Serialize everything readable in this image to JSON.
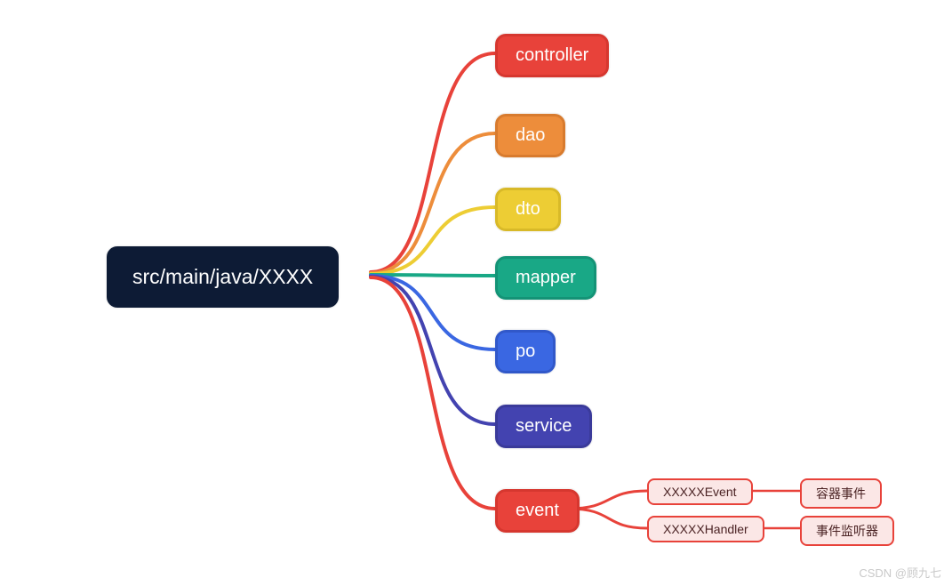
{
  "root": {
    "label": "src/main/java/XXXX"
  },
  "children": [
    {
      "id": "controller",
      "label": "controller",
      "color": "red"
    },
    {
      "id": "dao",
      "label": "dao",
      "color": "orange"
    },
    {
      "id": "dto",
      "label": "dto",
      "color": "yellow"
    },
    {
      "id": "mapper",
      "label": "mapper",
      "color": "green"
    },
    {
      "id": "po",
      "label": "po",
      "color": "blue"
    },
    {
      "id": "service",
      "label": "service",
      "color": "indigo"
    },
    {
      "id": "event",
      "label": "event",
      "color": "red2"
    }
  ],
  "event_children": [
    {
      "id": "xxxxxevent",
      "label": "XXXXXEvent",
      "desc": "容器事件"
    },
    {
      "id": "xxxxxhandler",
      "label": "XXXXXHandler",
      "desc": "事件监听器"
    }
  ],
  "watermark": "CSDN @顾九七",
  "colors": {
    "red": "#e8423a",
    "orange": "#ed8d3b",
    "yellow": "#edcd34",
    "green": "#19a886",
    "blue": "#3a67e2",
    "indigo": "#4343b0",
    "red2": "#e8423a"
  }
}
